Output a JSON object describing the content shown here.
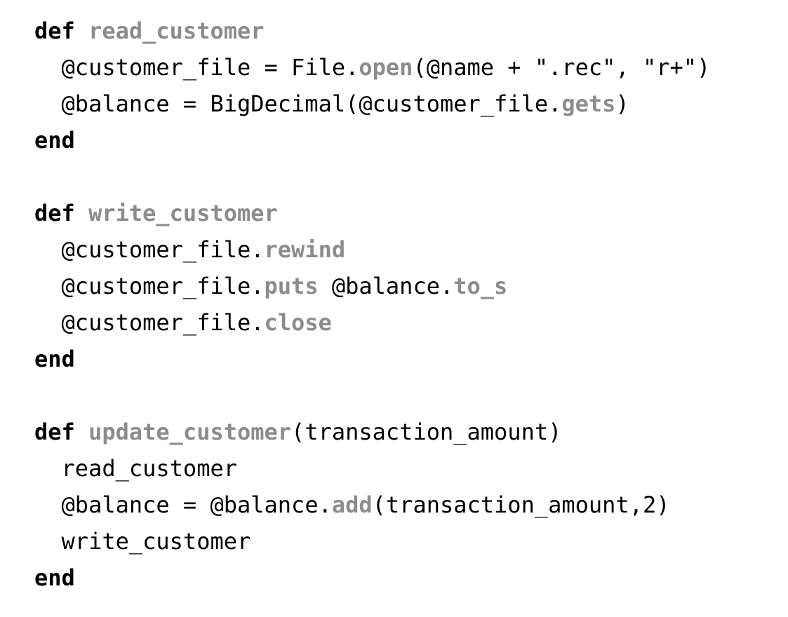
{
  "editor": {
    "language": "ruby",
    "background_color": "#ffffff",
    "text_color": "#000000",
    "highlight_color": "#8c8c8c",
    "font_size_px": 32,
    "line_height_px": 52,
    "indent": "  "
  },
  "code": {
    "full_text": "def read_customer\n  @customer_file = File.open(@name + \".rec\", \"r+\")\n  @balance = BigDecimal(@customer_file.gets)\nend\n\ndef write_customer\n  @customer_file.rewind\n  @customer_file.puts @balance.to_s\n  @customer_file.close\nend\n\ndef update_customer(transaction_amount)\n  read_customer\n  @balance = @balance.add(transaction_amount,2)\n  write_customer\nend",
    "lines": [
      {
        "index": 0,
        "blank": false,
        "tokens": [
          {
            "text": "def",
            "kind": "keyword"
          },
          {
            "text": " ",
            "kind": "plain"
          },
          {
            "text": "read_customer",
            "kind": "method"
          }
        ]
      },
      {
        "index": 1,
        "blank": false,
        "tokens": [
          {
            "text": "  ",
            "kind": "indent"
          },
          {
            "text": "@customer_file = File.",
            "kind": "plain"
          },
          {
            "text": "open",
            "kind": "method"
          },
          {
            "text": "(@name + \".rec\", \"r+\")",
            "kind": "plain"
          }
        ]
      },
      {
        "index": 2,
        "blank": false,
        "tokens": [
          {
            "text": "  ",
            "kind": "indent"
          },
          {
            "text": "@balance = BigDecimal(@customer_file.",
            "kind": "plain"
          },
          {
            "text": "gets",
            "kind": "method"
          },
          {
            "text": ")",
            "kind": "plain"
          }
        ]
      },
      {
        "index": 3,
        "blank": false,
        "tokens": [
          {
            "text": "end",
            "kind": "keyword"
          }
        ]
      },
      {
        "index": 4,
        "blank": true,
        "tokens": []
      },
      {
        "index": 5,
        "blank": false,
        "tokens": [
          {
            "text": "def",
            "kind": "keyword"
          },
          {
            "text": " ",
            "kind": "plain"
          },
          {
            "text": "write_customer",
            "kind": "method"
          }
        ]
      },
      {
        "index": 6,
        "blank": false,
        "tokens": [
          {
            "text": "  ",
            "kind": "indent"
          },
          {
            "text": "@customer_file.",
            "kind": "plain"
          },
          {
            "text": "rewind",
            "kind": "method"
          }
        ]
      },
      {
        "index": 7,
        "blank": false,
        "tokens": [
          {
            "text": "  ",
            "kind": "indent"
          },
          {
            "text": "@customer_file.",
            "kind": "plain"
          },
          {
            "text": "puts",
            "kind": "method"
          },
          {
            "text": " @balance.",
            "kind": "plain"
          },
          {
            "text": "to_s",
            "kind": "method"
          }
        ]
      },
      {
        "index": 8,
        "blank": false,
        "tokens": [
          {
            "text": "  ",
            "kind": "indent"
          },
          {
            "text": "@customer_file.",
            "kind": "plain"
          },
          {
            "text": "close",
            "kind": "method"
          }
        ]
      },
      {
        "index": 9,
        "blank": false,
        "tokens": [
          {
            "text": "end",
            "kind": "keyword"
          }
        ]
      },
      {
        "index": 10,
        "blank": true,
        "tokens": []
      },
      {
        "index": 11,
        "blank": false,
        "tokens": [
          {
            "text": "def",
            "kind": "keyword"
          },
          {
            "text": " ",
            "kind": "plain"
          },
          {
            "text": "update_customer",
            "kind": "method"
          },
          {
            "text": "(transaction_amount)",
            "kind": "plain"
          }
        ]
      },
      {
        "index": 12,
        "blank": false,
        "tokens": [
          {
            "text": "  ",
            "kind": "indent"
          },
          {
            "text": "read_customer",
            "kind": "plain"
          }
        ]
      },
      {
        "index": 13,
        "blank": false,
        "tokens": [
          {
            "text": "  ",
            "kind": "indent"
          },
          {
            "text": "@balance = @balance.",
            "kind": "plain"
          },
          {
            "text": "add",
            "kind": "method"
          },
          {
            "text": "(transaction_amount,2)",
            "kind": "plain"
          }
        ]
      },
      {
        "index": 14,
        "blank": false,
        "tokens": [
          {
            "text": "  ",
            "kind": "indent"
          },
          {
            "text": "write_customer",
            "kind": "plain"
          }
        ]
      },
      {
        "index": 15,
        "blank": false,
        "tokens": [
          {
            "text": "end",
            "kind": "keyword"
          }
        ]
      }
    ]
  }
}
